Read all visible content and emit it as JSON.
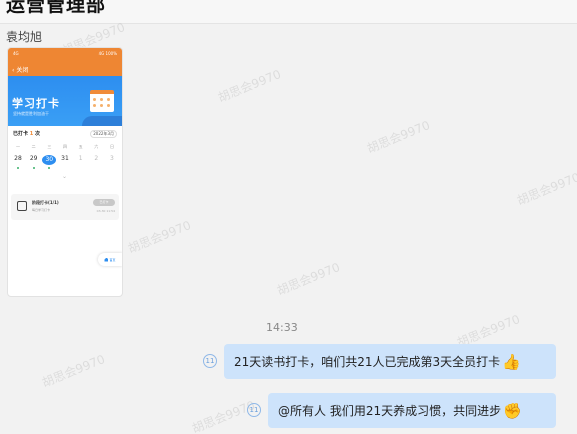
{
  "header": {
    "title": "运营管理部"
  },
  "watermark": "胡思会9970",
  "messages": {
    "sender_name": "袁均旭",
    "shared_card": {
      "statusbar_left": "4G",
      "statusbar_right": "4G 100%",
      "nav_back_label": "关闭",
      "banner_title": "学习打卡",
      "banner_subtitle": "坚持就是胜利加油干",
      "stat_label_prefix": "已打卡",
      "stat_count": "1",
      "stat_label_suffix": "次",
      "month": "2022年3月",
      "weekdays": [
        "一",
        "二",
        "三",
        "四",
        "五",
        "六",
        "日"
      ],
      "dates": [
        "28",
        "29",
        "30",
        "31",
        "1",
        "2",
        "3"
      ],
      "task": {
        "name": "阶段打卡(1/1)",
        "desc": "每日学习打卡",
        "button": "已打卡",
        "time": "03-30 11:54"
      },
      "home_label": "首页"
    },
    "timestamp": "14:33",
    "items": [
      {
        "text": "21天读书打卡，咱们共21人已完成第3天全员打卡",
        "emoji": "👍",
        "read_count": "11"
      },
      {
        "text": "@所有人  我们用21天养成习惯，共同进步",
        "emoji": "✊",
        "read_count": "11"
      }
    ]
  }
}
